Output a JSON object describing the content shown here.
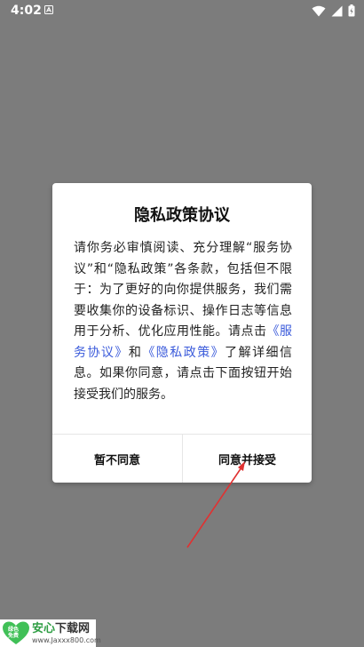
{
  "status_bar": {
    "time": "4:02"
  },
  "dialog": {
    "title": "隐私政策协议",
    "body_part1": "请你务必审慎阅读、充分理解“服务协议”和“隐私政策”各条款，包括但不限于：为了更好的向你提供服务，我们需要收集你的设备标识、操作日志等信息用于分析、优化应用性能。请点击",
    "link_service": "《服务协议》",
    "body_and": "和",
    "link_privacy": "《隐私政策》",
    "body_part2": "了解详细信息。如果你同意，请点击下面按钮开始接受我们的服务。",
    "decline_label": "暂不同意",
    "accept_label": "同意并接受"
  },
  "watermark": {
    "logo_text_1": "安心",
    "logo_text_2": "下载网",
    "url": "www.Jaxxx800.com",
    "badge_line1": "绿色",
    "badge_line2": "免费"
  },
  "colors": {
    "overlay": "#7c7c7c",
    "link": "#3b5bdb",
    "arrow": "#e03131",
    "brand_green": "#2f9e44"
  }
}
